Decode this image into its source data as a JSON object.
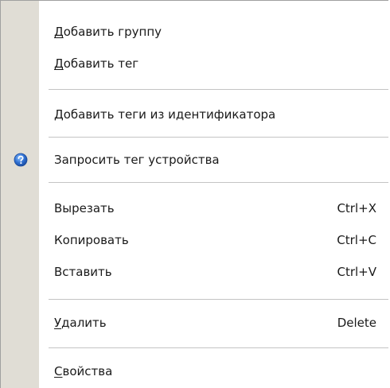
{
  "menu": {
    "add_group": {
      "accel": "Д",
      "rest": "обавить группу"
    },
    "add_tag": {
      "accel": "Д",
      "rest": "обавить тег"
    },
    "add_tags_from_id": {
      "label": "Добавить теги из идентификатора"
    },
    "query_device_tag": {
      "label": "Запросить тег устройства",
      "icon": "help-icon"
    },
    "cut": {
      "label": "Вырезать",
      "shortcut": "Ctrl+X"
    },
    "copy": {
      "label": "Копировать",
      "shortcut": "Ctrl+C"
    },
    "paste": {
      "label": "Вставить",
      "shortcut": "Ctrl+V"
    },
    "delete": {
      "accel": "У",
      "rest": "далить",
      "shortcut": "Delete"
    },
    "properties": {
      "accel": "С",
      "rest": "войства"
    }
  },
  "colors": {
    "gutter": "#e0ddd5",
    "separator": "#c4c4c4",
    "help_icon": "#2f6fd1"
  }
}
